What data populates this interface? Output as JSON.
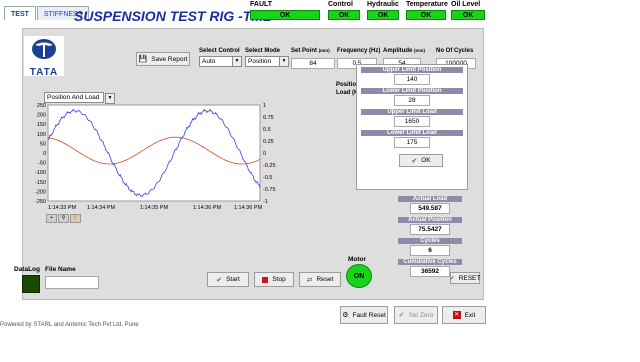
{
  "tabs": [
    "TEST",
    "STIFFNESS"
  ],
  "title": "SUSPENSION TEST RIG -TML",
  "status": [
    {
      "label": "FAULT",
      "value": "OK"
    },
    {
      "label": "Control",
      "value": "OK"
    },
    {
      "label": "Hydraulic",
      "value": "OK"
    },
    {
      "label": "Temperature",
      "value": "OK"
    },
    {
      "label": "Oil Level",
      "value": "OK"
    }
  ],
  "logo_text": "TATA",
  "save_report_label": "Save Report",
  "controls": {
    "select_control_label": "Select Control",
    "select_control_value": "Auto",
    "select_mode_label": "Select Mode",
    "select_mode_value": "Position",
    "set_point_label": "Set Point",
    "set_point_unit": "(mm)",
    "set_point_value": "84",
    "frequency_label": "Frequency (Hz)",
    "frequency_value": "0.5",
    "amplitude_label": "Amplitude",
    "amplitude_unit": "(mm)",
    "amplitude_value": "54",
    "cycles_label": "No Of Cycles",
    "cycles_value": "100000"
  },
  "chart_selector": "Position And Load",
  "legend_position": "Position (mm)",
  "legend_load": "Load (Kg)",
  "chart_data": {
    "type": "line",
    "x_ticks": [
      "1:14:33 PM",
      "1:14:34 PM",
      "1:14:35 PM",
      "1:14:36 PM",
      "1:14:36 PM"
    ],
    "y_left_ticks": [
      250,
      200,
      150,
      100,
      50,
      0,
      -50,
      -100,
      -150,
      -200,
      -250
    ],
    "y_right_ticks": [
      "1",
      "0.75",
      "0.5",
      "0.25",
      "0",
      "-0.25",
      "-0.5",
      "-0.75",
      "-1"
    ],
    "ylim_left": [
      -250,
      250
    ],
    "ylim_right": [
      -1,
      1
    ],
    "series": [
      {
        "color": "#3a46d6",
        "axis": "left",
        "amplitude": 220,
        "period": 2.0,
        "phase": 0.3,
        "noisy": true
      },
      {
        "color": "#e0452a",
        "axis": "right",
        "amplitude": 0.28,
        "period": 2.0,
        "phase": 1.8,
        "offset": 0.05,
        "noisy": false
      }
    ],
    "grid": false
  },
  "limits": {
    "upper_position_label": "Upper Limit Position",
    "upper_position_value": "140",
    "lower_position_label": "Lower Limit Position",
    "lower_position_value": "28",
    "upper_load_label": "Upper Limit Load",
    "upper_load_value": "1650",
    "lower_load_label": "Lower Limit Load",
    "lower_load_value": "175",
    "ok_label": "OK"
  },
  "actuals": {
    "load_label": "Actual Load",
    "load_value": "549.587",
    "position_label": "Actual Position",
    "position_value": "75.5427",
    "cycles_label": "Cycles",
    "cycles_value": "6",
    "cum_label": "Cumulative Cycles",
    "cum_value": "36592",
    "reset_label": "RESET"
  },
  "datalog_label": "DataLog",
  "file_name_label": "File Name",
  "file_name_value": "",
  "start_label": "Start",
  "stop_label": "Stop",
  "reset_label": "Reset",
  "motor_label": "Motor",
  "motor_value": "ON",
  "fault_reset_label": "Fault Reset",
  "set_zero_label": "Set Zero",
  "exit_label": "Exit",
  "footer_text": "Powered by STARL and Antemic Tech Pvt Ltd, Pune"
}
